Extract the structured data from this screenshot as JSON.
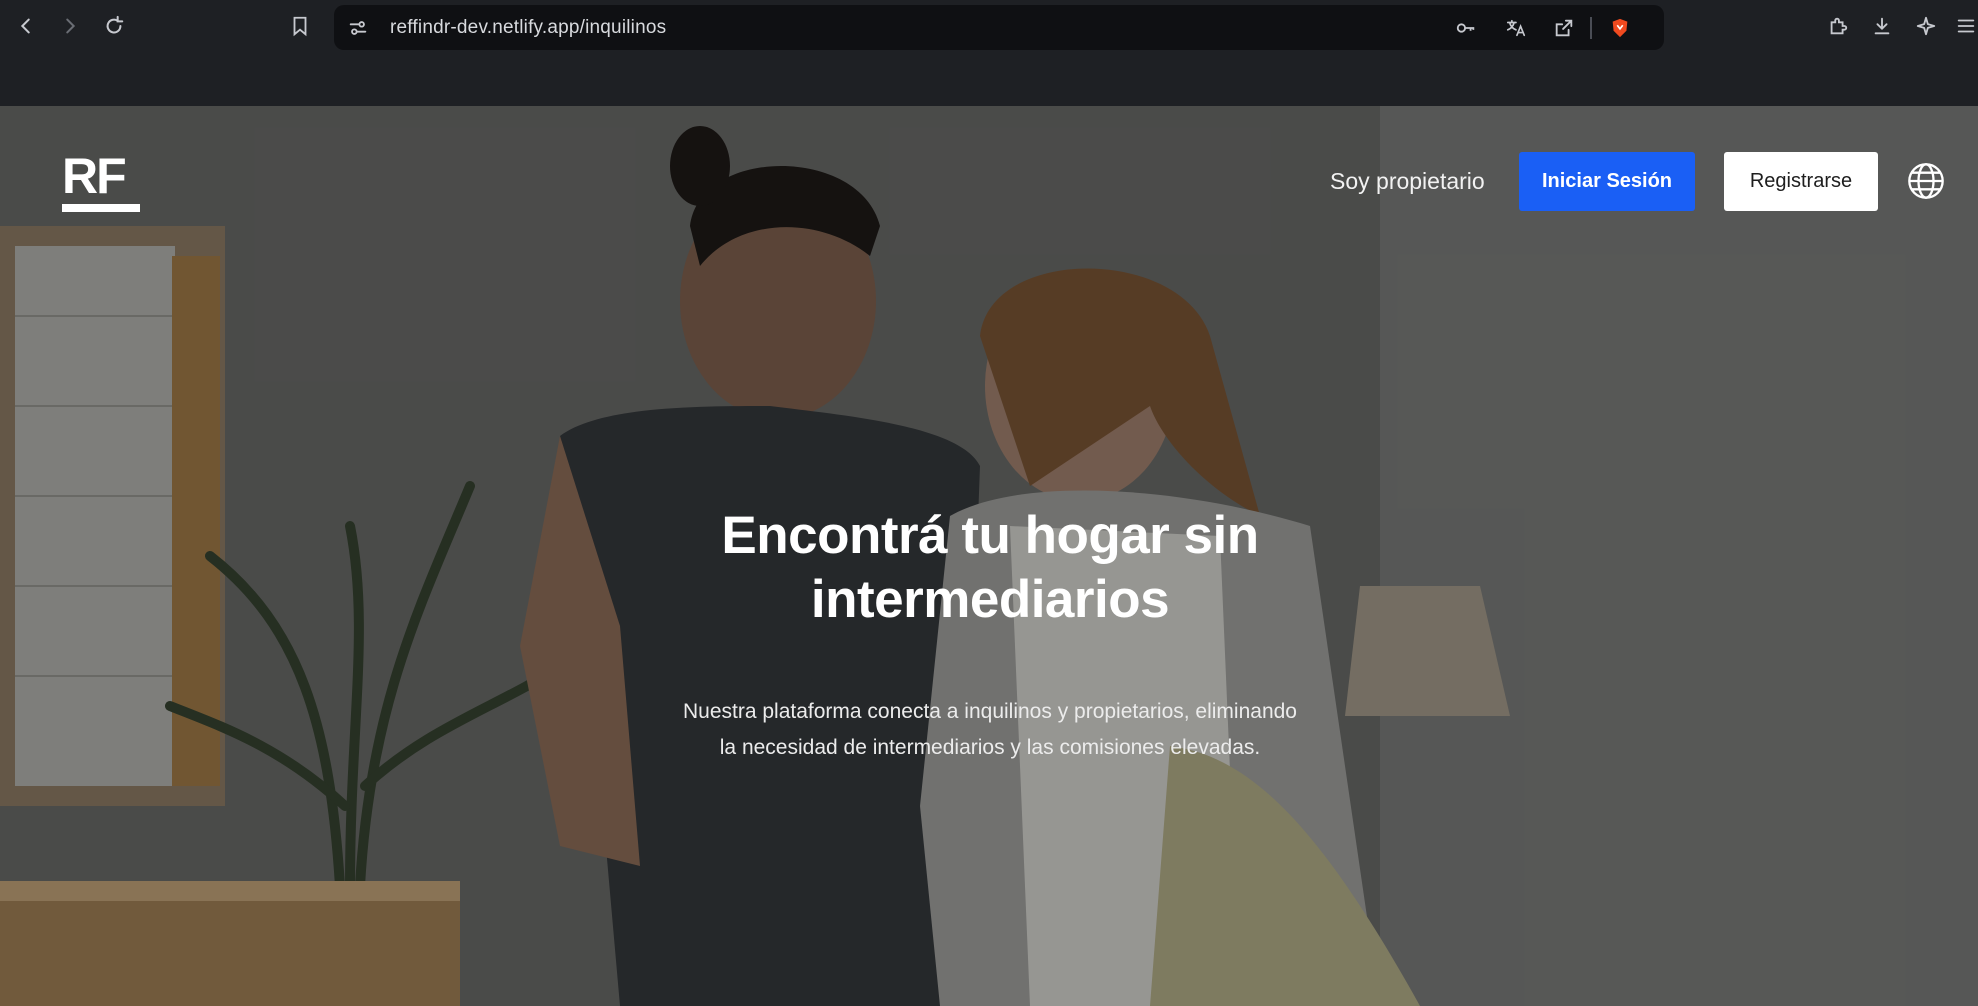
{
  "browser": {
    "url": "reffindr-dev.netlify.app/inquilinos",
    "icons": [
      "back-icon",
      "forward-icon",
      "reload-icon",
      "bookmark-icon",
      "site-settings-icon",
      "password-key-icon",
      "translate-icon",
      "share-icon",
      "brave-shield-icon",
      "extensions-icon",
      "download-icon",
      "leo-ai-icon",
      "menu-icon"
    ]
  },
  "nav": {
    "logo": "RF",
    "owner_link": "Soy propietario",
    "login_label": "Iniciar Sesión",
    "register_label": "Registrarse",
    "language_icon": "globe-icon"
  },
  "hero": {
    "headline_line1": "Encontrá tu hogar sin",
    "headline_line2": "intermediarios",
    "sub_line1": "Nuestra plataforma conecta a inquilinos y propietarios, eliminando",
    "sub_line2": "la necesidad de intermediarios y las comisiones elevadas."
  },
  "colors": {
    "primary": "#1a5ff5",
    "chrome_bg": "#1e2024",
    "urlbar_bg": "#0f1013"
  }
}
